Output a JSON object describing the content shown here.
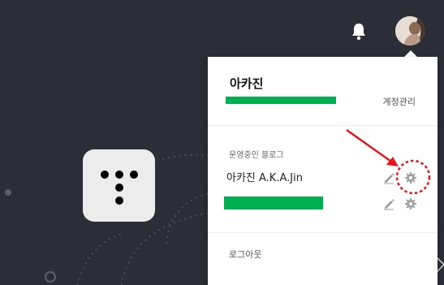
{
  "header": {
    "notification_icon": "bell-icon",
    "avatar_icon": "profile-photo"
  },
  "account_menu": {
    "user_name": "아카진",
    "email_display": "·······@··········",
    "account_manage_label": "계정관리",
    "section_label": "운영중인 블로그",
    "blogs": [
      {
        "name": "아카진 A.K.A.Jin",
        "edit_icon": "pencil-icon",
        "settings_icon": "gear-icon"
      },
      {
        "name": "",
        "edit_icon": "pencil-icon",
        "settings_icon": "gear-icon"
      }
    ],
    "logout_label": "로그아웃"
  },
  "colors": {
    "background": "#2b2e37",
    "panel": "#ffffff",
    "redaction": "#00b050",
    "annotation": "#e8141b"
  }
}
